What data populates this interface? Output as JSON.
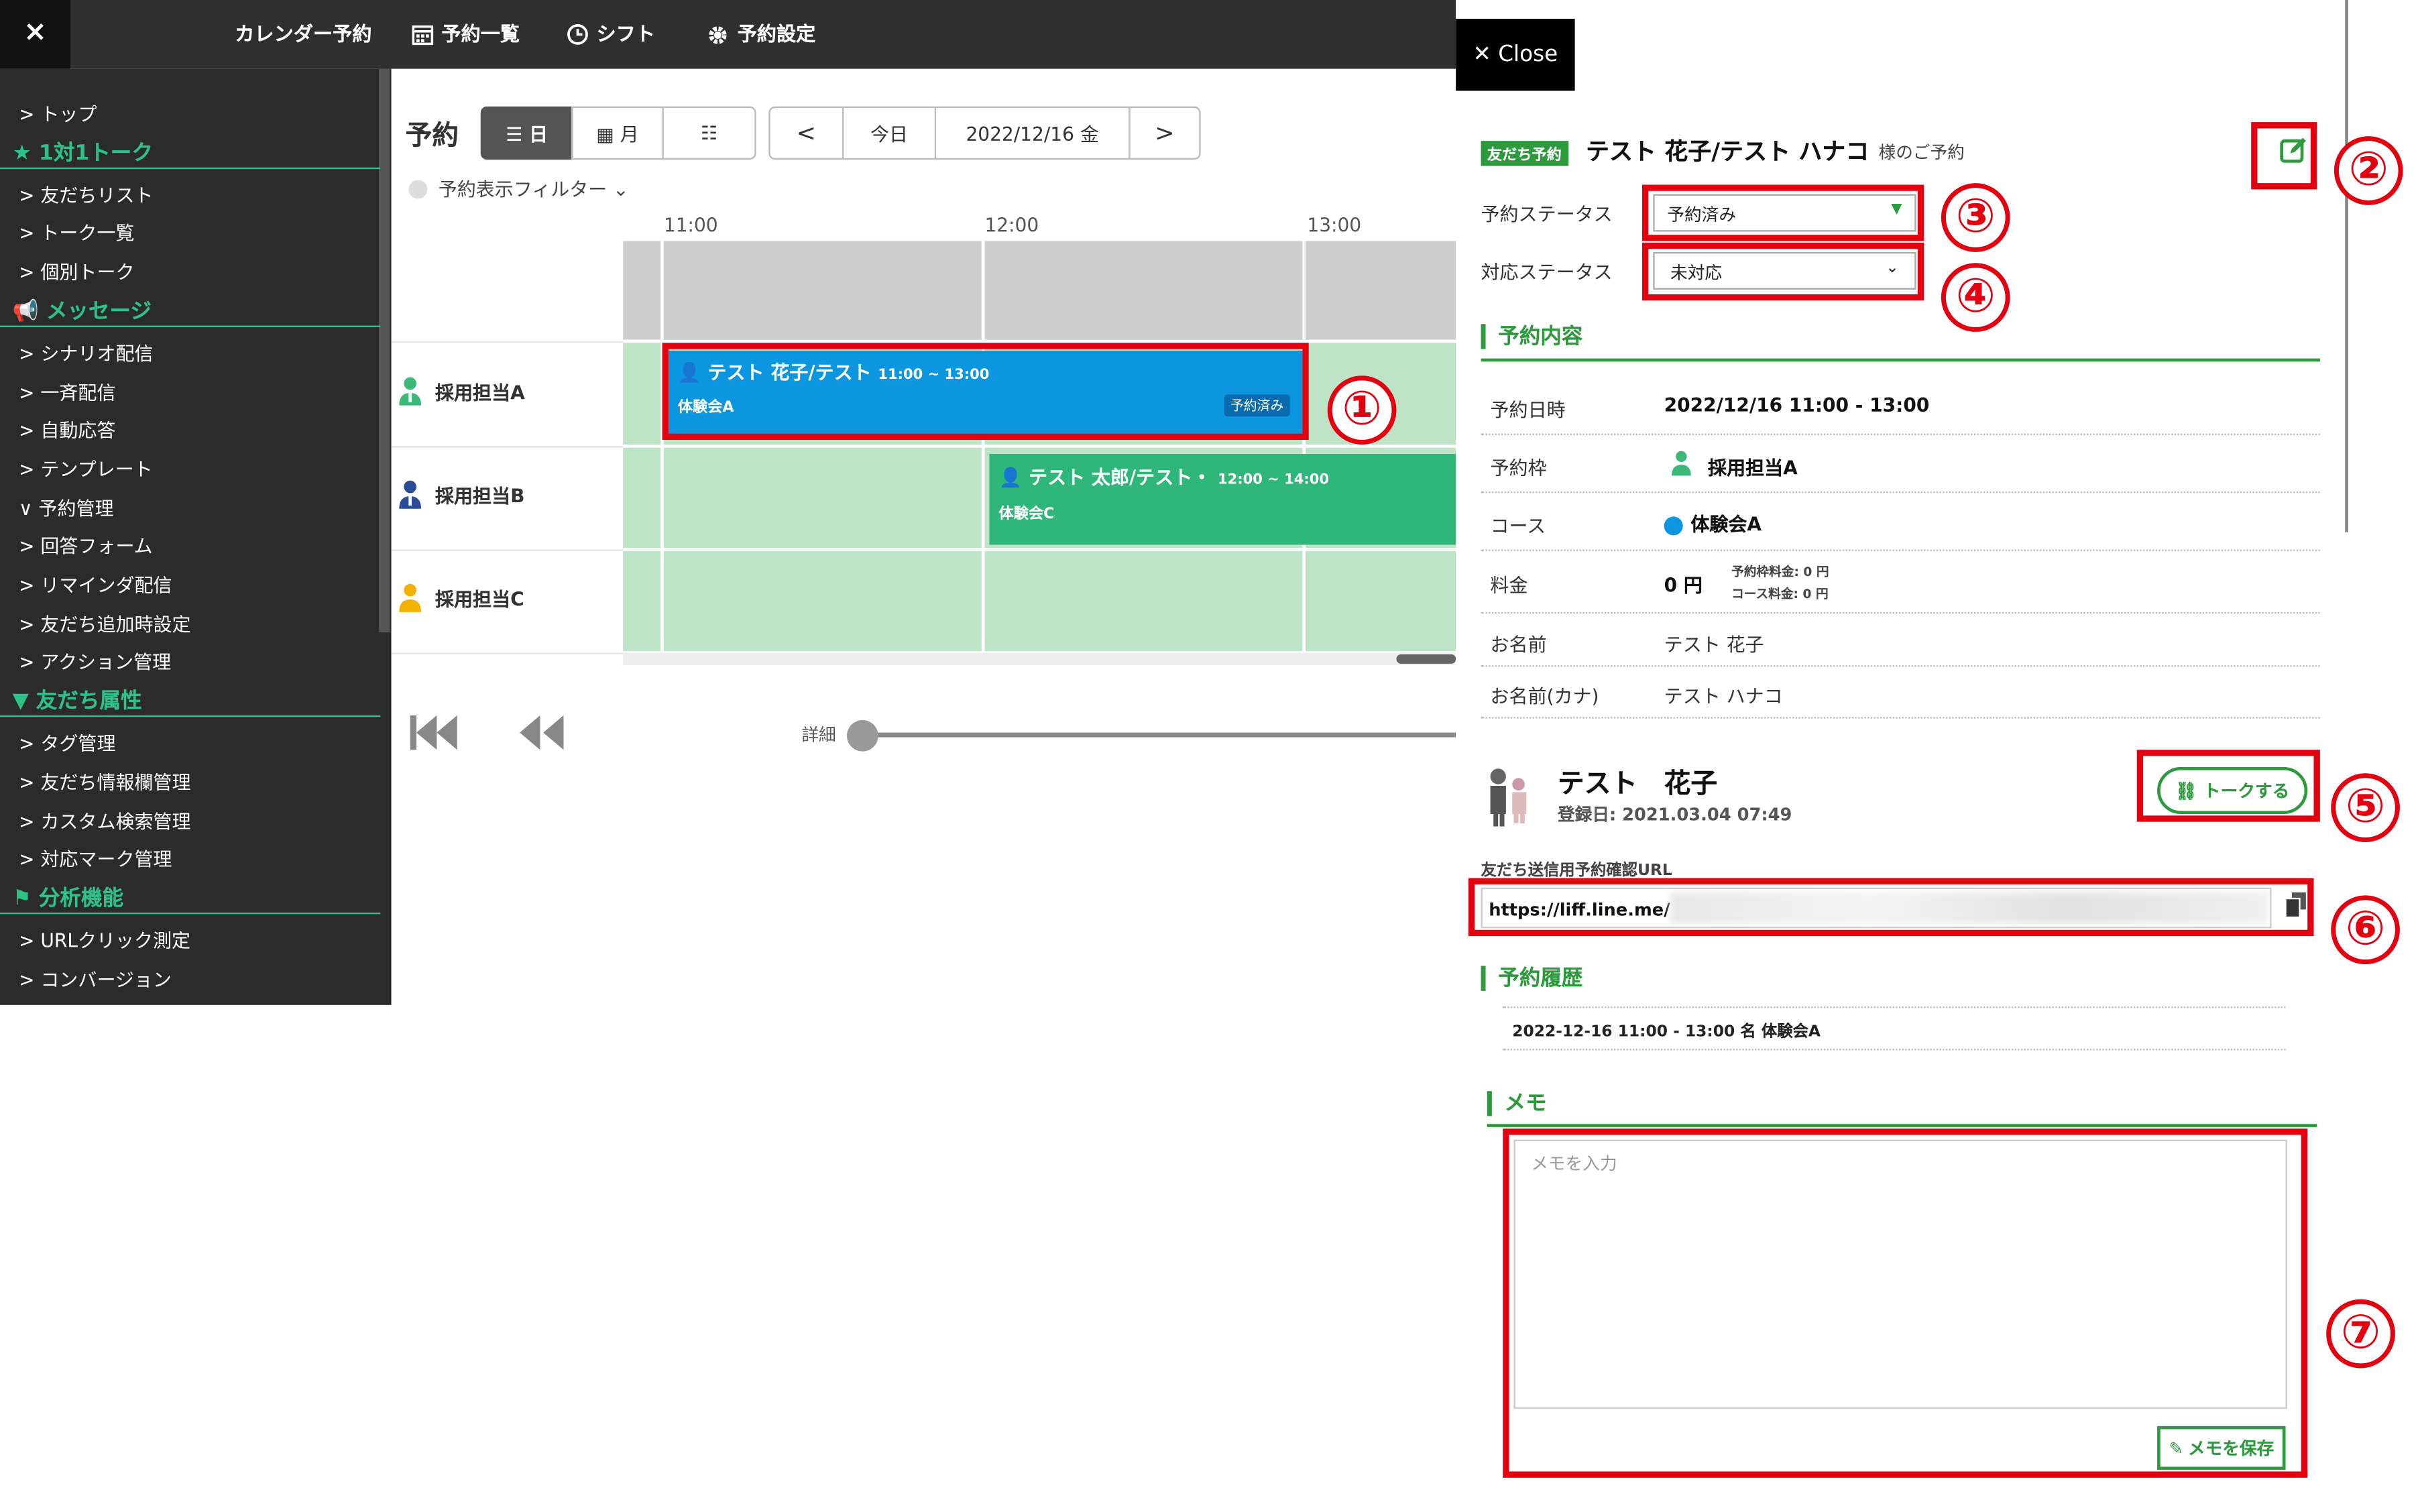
{
  "topbar": {
    "close": "×",
    "nav": [
      {
        "label": "カレンダー予約",
        "icon": "none"
      },
      {
        "label": "予約一覧",
        "icon": "calendar-icon"
      },
      {
        "label": "シフト",
        "icon": "clock-icon"
      },
      {
        "label": "予約設定",
        "icon": "gear-icon"
      }
    ]
  },
  "sidebar": {
    "items": [
      {
        "type": "item",
        "label": "> トップ"
      },
      {
        "type": "head",
        "label": "★ 1対1トーク"
      },
      {
        "type": "item",
        "label": "> 友だちリスト"
      },
      {
        "type": "item",
        "label": "> トーク一覧"
      },
      {
        "type": "item",
        "label": "> 個別トーク"
      },
      {
        "type": "head",
        "label": "📢 メッセージ"
      },
      {
        "type": "item",
        "label": "> シナリオ配信"
      },
      {
        "type": "item",
        "label": "> 一斉配信"
      },
      {
        "type": "item",
        "label": "> 自動応答"
      },
      {
        "type": "item",
        "label": "> テンプレート"
      },
      {
        "type": "item",
        "label": "∨ 予約管理"
      },
      {
        "type": "item",
        "label": "> 回答フォーム"
      },
      {
        "type": "item",
        "label": "> リマインダ配信"
      },
      {
        "type": "item",
        "label": "> 友だち追加時設定"
      },
      {
        "type": "item",
        "label": "> アクション管理"
      },
      {
        "type": "head",
        "label": "▼ 友だち属性"
      },
      {
        "type": "item",
        "label": "> タグ管理"
      },
      {
        "type": "item",
        "label": "> 友だち情報欄管理"
      },
      {
        "type": "item",
        "label": "> カスタム検索管理"
      },
      {
        "type": "item",
        "label": "> 対応マーク管理"
      },
      {
        "type": "head",
        "label": "⚑ 分析機能"
      },
      {
        "type": "item",
        "label": "> URLクリック測定"
      },
      {
        "type": "item",
        "label": "> コンバージョン"
      }
    ]
  },
  "main": {
    "title": "予約",
    "view_day": "☰ 日",
    "view_month": "▦ 月",
    "view_list": "☷",
    "prev": "<",
    "today": "今日",
    "date": "2022/12/16 金",
    "next": ">",
    "filter": "予約表示フィルター ⌄",
    "times": [
      "11:00",
      "12:00",
      "13:00"
    ],
    "staff": [
      {
        "name": "採用担当A",
        "color": "#3cb878"
      },
      {
        "name": "採用担当B",
        "color": "#2a4a9a"
      },
      {
        "name": "採用担当C",
        "color": "#f3b200"
      }
    ],
    "events": [
      {
        "title": "👤 テスト 花子/テスト",
        "time": "11:00 ~ 13:00",
        "course": "体験会A",
        "badge": "予約済み",
        "color": "#0d96e0"
      },
      {
        "title": "👤 テスト 太郎/テスト・",
        "time": "12:00 ~ 14:00",
        "course": "体験会C",
        "badge": "",
        "color": "#2fb67a"
      }
    ],
    "detail_label": "詳細"
  },
  "panel": {
    "close": "✕ Close",
    "badge": "友だち予約",
    "name": "テスト 花子/テスト ハナコ",
    "suffix": "様のご予約",
    "status_label": "予約ステータス",
    "status_value": "予約済み",
    "resp_label": "対応ステータス",
    "resp_value": "未対応",
    "section_detail": "予約内容",
    "rows": [
      {
        "label": "予約日時",
        "value": "2022/12/16 11:00 - 13:00"
      },
      {
        "label": "予約枠",
        "value": "採用担当A"
      },
      {
        "label": "コース",
        "value": "体験会A"
      },
      {
        "label": "料金",
        "value": "0 円"
      },
      {
        "label": "お名前",
        "value": "テスト 花子"
      },
      {
        "label": "お名前(カナ)",
        "value": "テスト ハナコ"
      }
    ],
    "fee_slot": "予約枠料金: 0 円",
    "fee_course": "コース料金: 0 円",
    "friend_name": "テスト　花子",
    "registered": "登録日: 2021.03.04 07:49",
    "talk_button": "トークする",
    "url_label": "友だち送信用予約確認URL",
    "url_value": "https://liff.line.me/",
    "section_history": "予約履歴",
    "history": "2022-12-16 11:00 - 13:00 名 体験会A",
    "section_memo": "メモ",
    "memo_placeholder": "メモを入力",
    "memo_save": "メモを保存"
  },
  "annotations": [
    "①",
    "②",
    "③",
    "④",
    "⑤",
    "⑥",
    "⑦"
  ],
  "colors": {
    "annotation": "#e3000f",
    "accent": "#2e9a3e",
    "sidebar_accent": "#2ec28a"
  }
}
